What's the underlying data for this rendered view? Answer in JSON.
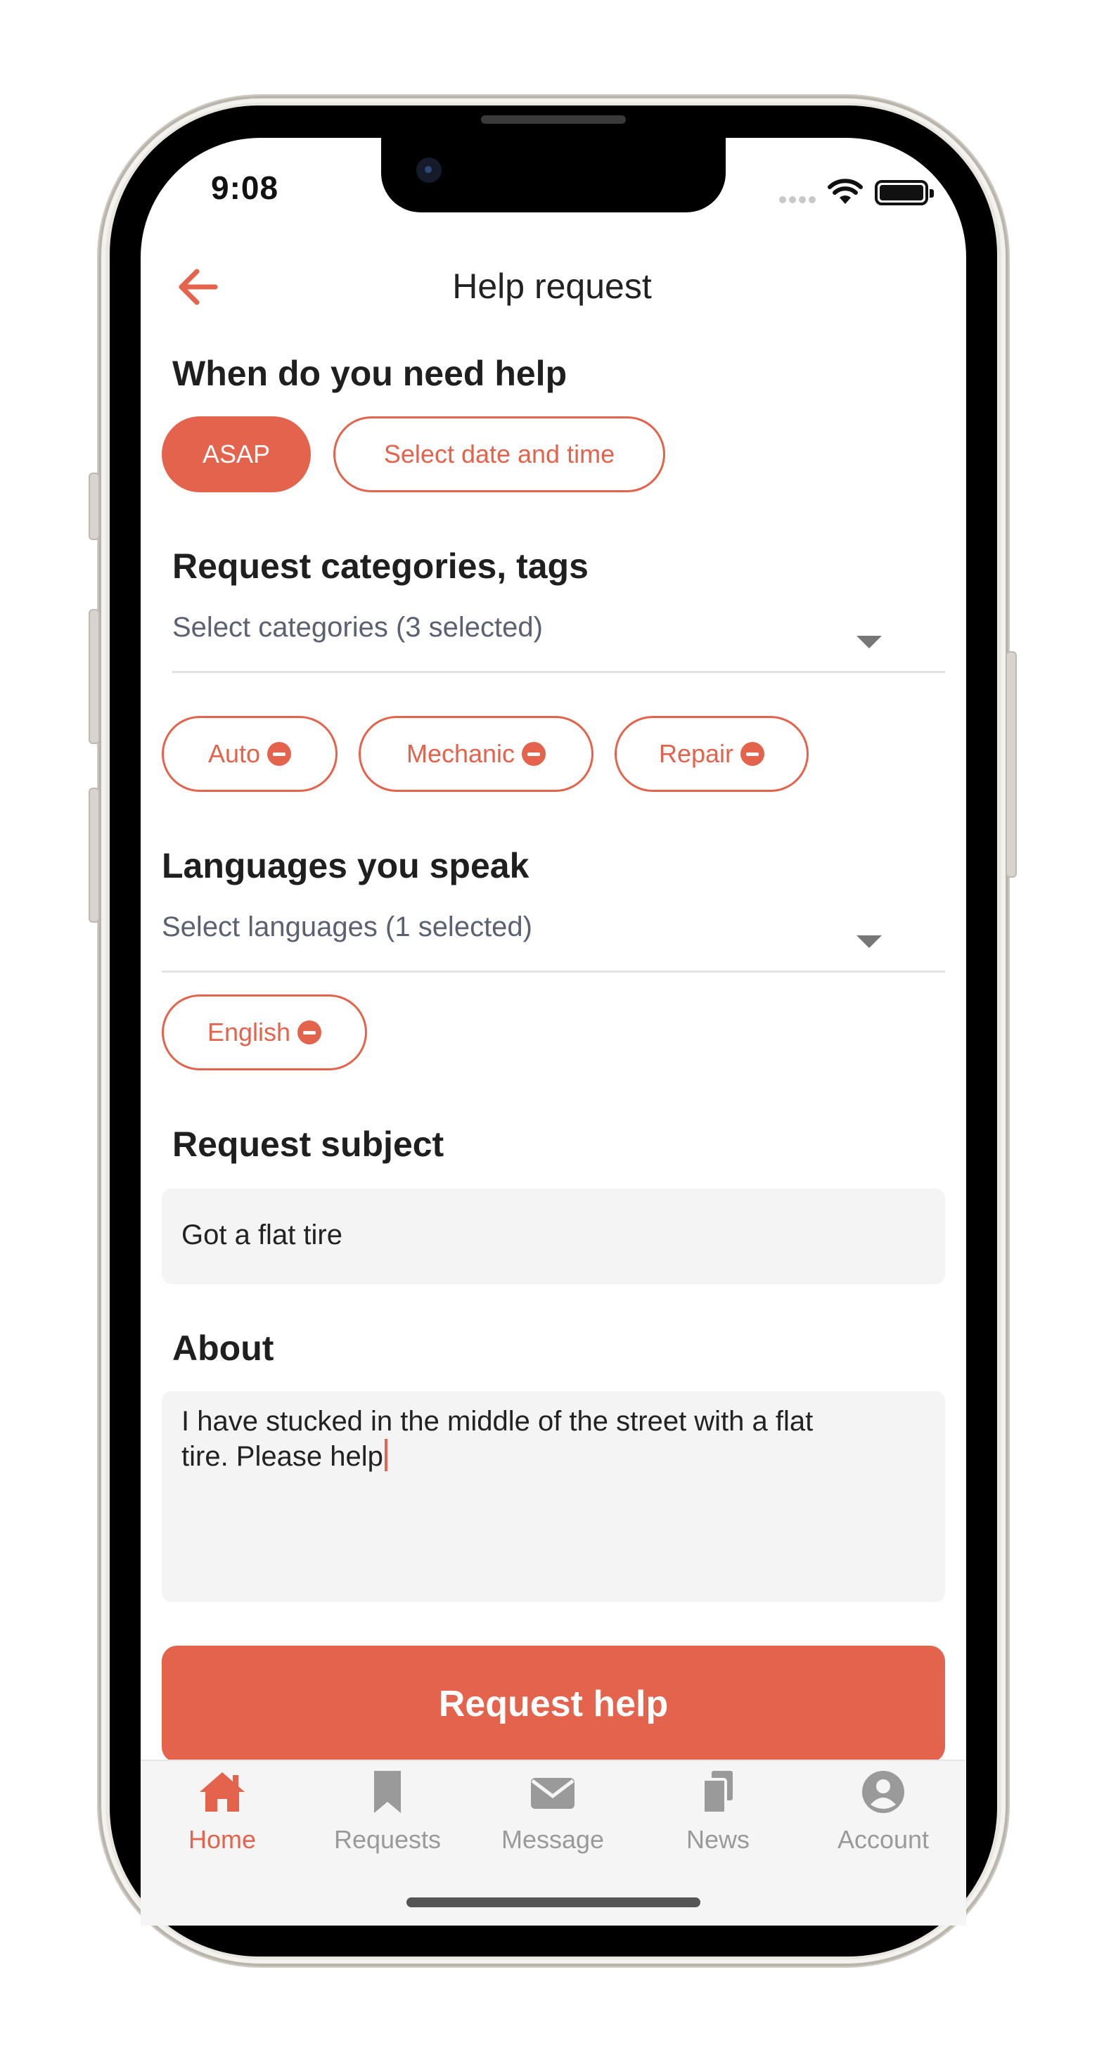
{
  "status_bar": {
    "time": "9:08"
  },
  "header": {
    "title": "Help request",
    "back_icon": "arrow-left-icon"
  },
  "when": {
    "title": "When do you need help",
    "options": [
      {
        "label": "ASAP",
        "selected": true
      },
      {
        "label": "Select date and time",
        "selected": false
      }
    ]
  },
  "categories": {
    "title": "Request categories, tags",
    "dropdown_text": "Select categories (3 selected)",
    "chips": [
      "Auto",
      "Mechanic",
      "Repair"
    ]
  },
  "languages": {
    "title": "Languages you speak",
    "dropdown_text": "Select languages (1 selected)",
    "chips": [
      "English"
    ]
  },
  "subject": {
    "title": "Request subject",
    "value": "Got a flat tire"
  },
  "about": {
    "title": "About",
    "value_line1": "I have stucked in the middle of the street with a flat",
    "value_line2": "tire. Please help"
  },
  "submit_label": "Request help",
  "tabs": [
    {
      "label": "Home",
      "icon": "home-icon",
      "active": true
    },
    {
      "label": "Requests",
      "icon": "bookmark-icon",
      "active": false
    },
    {
      "label": "Message",
      "icon": "envelope-icon",
      "active": false
    },
    {
      "label": "News",
      "icon": "documents-icon",
      "active": false
    },
    {
      "label": "Account",
      "icon": "account-icon",
      "active": false
    }
  ],
  "colors": {
    "accent": "#e4634c",
    "field_bg": "#f4f4f4",
    "tab_inactive": "#9a9a9a"
  }
}
